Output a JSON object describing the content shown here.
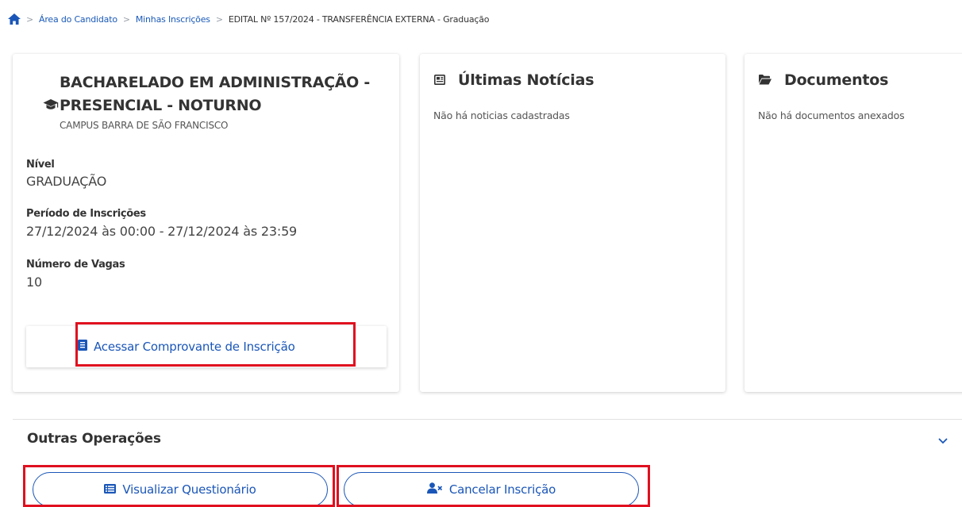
{
  "breadcrumb": {
    "home_icon": "home-icon",
    "items": [
      "Área do Candidato",
      "Minhas Inscrições"
    ],
    "current": "EDITAL Nº 157/2024 - TRANSFERÊNCIA EXTERNA - Graduação",
    "separator": ">"
  },
  "course": {
    "icon": "graduation-cap-icon",
    "title": "BACHARELADO EM ADMINISTRAÇÃO - PRESENCIAL - NOTURNO",
    "campus": "CAMPUS BARRA DE SÃO FRANCISCO",
    "level_label": "Nível",
    "level_value": "GRADUAÇÃO",
    "period_label": "Período de Inscrições",
    "period_value": "27/12/2024 às 00:00 - 27/12/2024 às 23:59",
    "vacancies_label": "Número de Vagas",
    "vacancies_value": "10",
    "receipt_button": "Acessar Comprovante de Inscrição",
    "receipt_icon": "receipt-icon"
  },
  "news": {
    "icon": "newspaper-icon",
    "title": "Últimas Notícias",
    "empty": "Não há noticias cadastradas"
  },
  "documents": {
    "icon": "folder-open-icon",
    "title": "Documentos",
    "empty": "Não há documentos anexados"
  },
  "operations": {
    "title": "Outras Operações",
    "questionnaire_button": "Visualizar Questionário",
    "questionnaire_icon": "list-icon",
    "cancel_button": "Cancelar Inscrição",
    "cancel_icon": "user-remove-icon"
  },
  "colors": {
    "link": "#1a56b8",
    "highlight": "#e0101f",
    "text": "#333333"
  }
}
